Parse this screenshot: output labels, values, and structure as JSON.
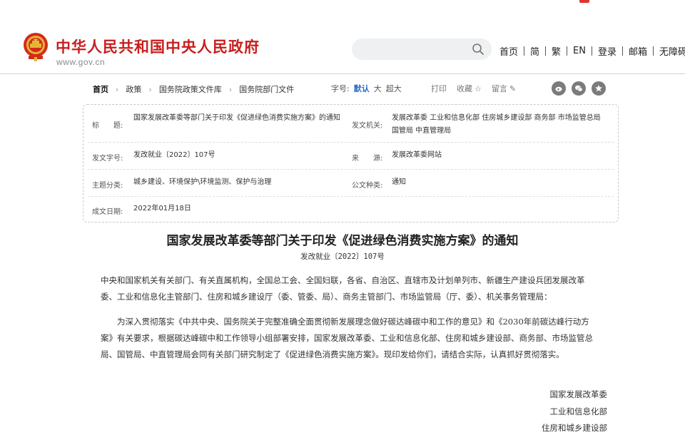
{
  "site": {
    "title": "中华人民共和国中央人民政府",
    "url": "www.gov.cn"
  },
  "search": {
    "placeholder": "",
    "value": ""
  },
  "topnav": {
    "items": [
      "首页",
      "简",
      "繁",
      "EN",
      "登录",
      "邮箱",
      "无障碍"
    ]
  },
  "breadcrumb": {
    "items": [
      "首页",
      "政策",
      "国务院政策文件库",
      "国务院部门文件"
    ]
  },
  "fontsize": {
    "label": "字号:",
    "options": [
      "默认",
      "大",
      "超大"
    ],
    "selected": "默认"
  },
  "tools": {
    "print": "打印",
    "favorite": "收藏",
    "comment": "留言"
  },
  "share_icons": [
    "weibo-icon",
    "wechat-icon",
    "star-icon"
  ],
  "meta": {
    "title_label": "标　　题:",
    "title_value": "国家发展改革委等部门关于印发《促进绿色消费实施方案》的通知",
    "issuer_label": "发文机关:",
    "issuer_value": "发展改革委  工业和信息化部  住房城乡建设部  商务部  市场监管总局  国管局  中直管理局",
    "docno_label": "发文字号:",
    "docno_value": "发改就业〔2022〕107号",
    "source_label": "来　　源:",
    "source_value": "发展改革委网站",
    "category_label": "主题分类:",
    "category_value": "城乡建设、环境保护\\环境监测、保护与治理",
    "type_label": "公文种类:",
    "type_value": "通知",
    "date_label": "成文日期:",
    "date_value": "2022年01月18日"
  },
  "document": {
    "title": "国家发展改革委等部门关于印发《促进绿色消费实施方案》的通知",
    "number": "发改就业〔2022〕107号",
    "paragraph1": "中央和国家机关有关部门、有关直属机构，全国总工会、全国妇联，各省、自治区、直辖市及计划单列市、新疆生产建设兵团发展改革委、工业和信息化主管部门、住房和城乡建设厅（委、管委、局）、商务主管部门、市场监管局（厅、委）、机关事务管理局：",
    "paragraph2": "为深入贯彻落实《中共中央、国务院关于完整准确全面贯彻新发展理念做好碳达峰碳中和工作的意见》和《2030年前碳达峰行动方案》有关要求，根据碳达峰碳中和工作领导小组部署安排，国家发展改革委、工业和信息化部、住房和城乡建设部、商务部、市场监管总局、国管局、中直管理局会同有关部门研究制定了《促进绿色消费实施方案》。现印发给你们，请结合实际，认真抓好贯彻落实。",
    "signatories": [
      "国家发展改革委",
      "工业和信息化部",
      "住房和城乡建设部"
    ]
  },
  "colors": {
    "brand_red": "#c81e1e",
    "accent_blue": "#2b6cc9"
  }
}
